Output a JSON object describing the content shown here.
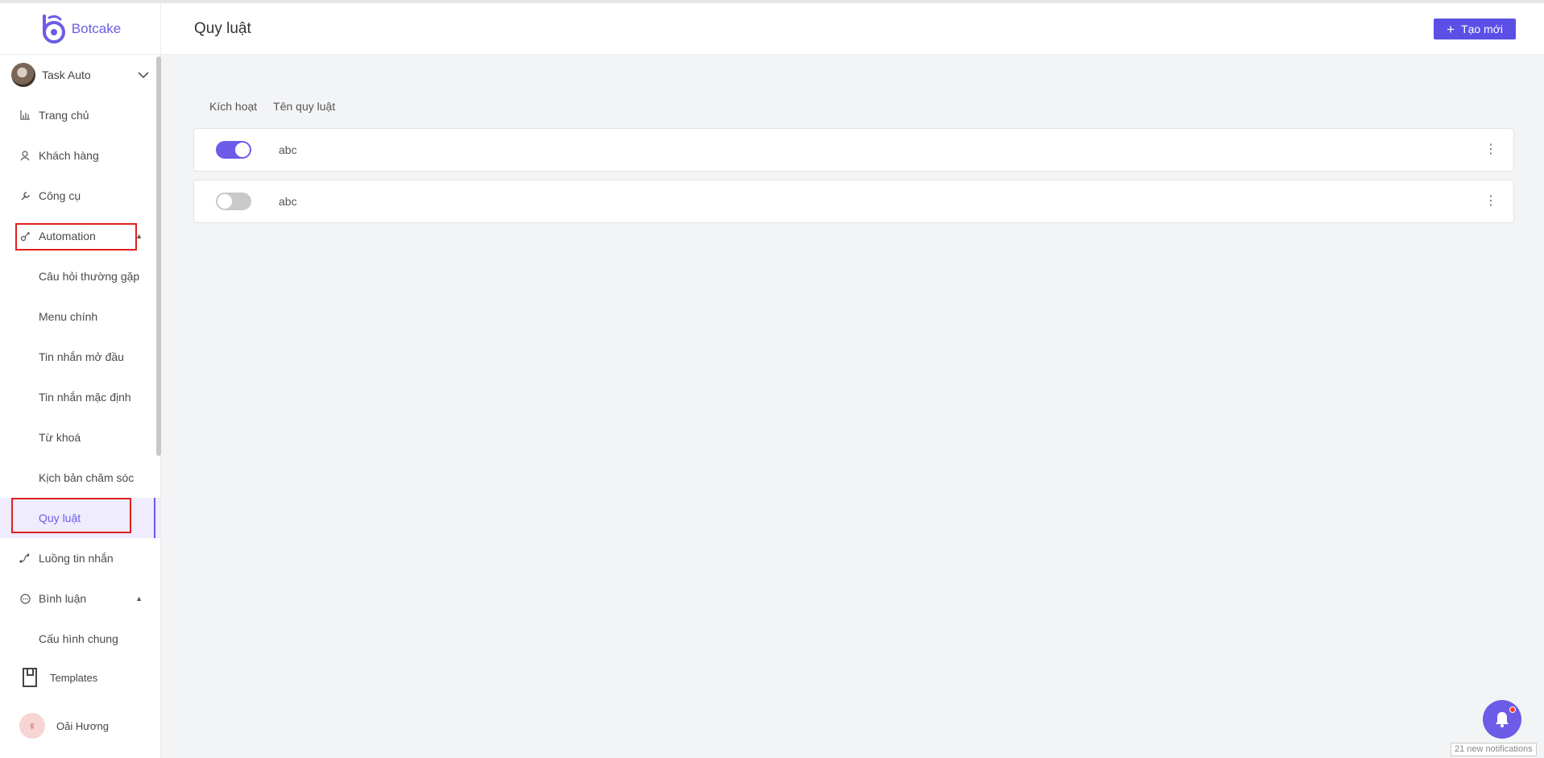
{
  "app": {
    "name": "Botcake",
    "accent": "#6c5ce7",
    "highlight": "#e02020"
  },
  "workspace": {
    "name": "Task Auto",
    "icon": "chevron-down-icon"
  },
  "sidebar": {
    "items": [
      {
        "label": "Trang chủ",
        "icon": "bar-chart-icon"
      },
      {
        "label": "Khách hàng",
        "icon": "user-icon"
      },
      {
        "label": "Công cụ",
        "icon": "wrench-icon"
      },
      {
        "label": "Automation",
        "icon": "robot-icon"
      },
      {
        "label": "Câu hỏi thường gặp"
      },
      {
        "label": "Menu chính"
      },
      {
        "label": "Tin nhắn mở đầu"
      },
      {
        "label": "Tin nhắn mặc định"
      },
      {
        "label": "Từ khoá"
      },
      {
        "label": "Kịch bản chăm sóc"
      },
      {
        "label": "Quy luật"
      },
      {
        "label": "Luồng tin nhắn",
        "icon": "flow-icon"
      },
      {
        "label": "Bình luận",
        "icon": "comment-icon"
      },
      {
        "label": "Cấu hình chung"
      }
    ],
    "templates_label": "Templates",
    "user_name": "Oải Hương"
  },
  "header": {
    "title": "Quy luật",
    "create_button": "Tạo mới"
  },
  "table": {
    "columns": [
      "Kích hoạt",
      "Tên quy luật"
    ],
    "rows": [
      {
        "active": true,
        "name": "abc"
      },
      {
        "active": false,
        "name": "abc"
      }
    ]
  },
  "notifications": {
    "label": "21 new notifications",
    "count": 21
  }
}
